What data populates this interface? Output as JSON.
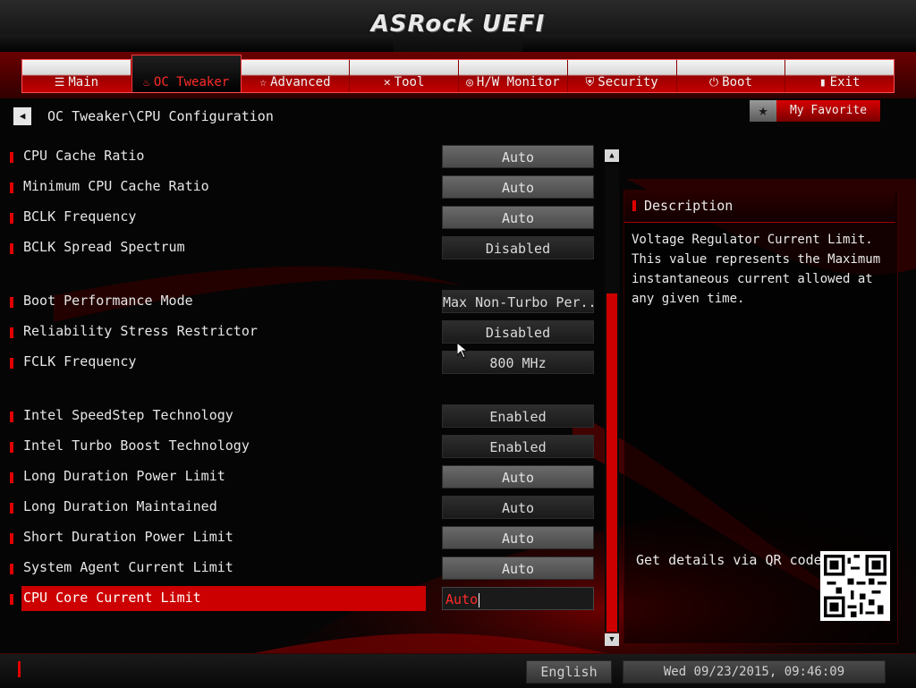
{
  "header": {
    "brand": "ASRock UEFI"
  },
  "nav": {
    "tabs": [
      {
        "label": "Main",
        "icon": "list-icon",
        "glyph": "☰",
        "active": false
      },
      {
        "label": "OC Tweaker",
        "icon": "flame-icon",
        "glyph": "♨",
        "active": true
      },
      {
        "label": "Advanced",
        "icon": "star-icon",
        "glyph": "☆",
        "active": false
      },
      {
        "label": "Tool",
        "icon": "tools-icon",
        "glyph": "✕",
        "active": false
      },
      {
        "label": "H/W Monitor",
        "icon": "monitor-icon",
        "glyph": "◎",
        "active": false
      },
      {
        "label": "Security",
        "icon": "shield-icon",
        "glyph": "⛨",
        "active": false
      },
      {
        "label": "Boot",
        "icon": "power-icon",
        "glyph": "⏻",
        "active": false
      },
      {
        "label": "Exit",
        "icon": "exit-door-icon",
        "glyph": "▮",
        "active": false
      }
    ]
  },
  "breadcrumb": {
    "path": "OC Tweaker\\CPU Configuration",
    "back_icon": "back-arrow-icon"
  },
  "favorite": {
    "label": "My Favorite",
    "icon": "star-icon"
  },
  "settings": [
    {
      "label": "CPU Cache Ratio",
      "value": "Auto",
      "style": "light"
    },
    {
      "label": "Minimum CPU Cache Ratio",
      "value": "Auto",
      "style": "light"
    },
    {
      "label": "BCLK Frequency",
      "value": "Auto",
      "style": "light"
    },
    {
      "label": "BCLK Spread Spectrum",
      "value": "Disabled",
      "style": "dark"
    },
    {
      "label": "Boot Performance Mode",
      "value": "Max Non-Turbo Per...",
      "style": "dark"
    },
    {
      "label": "Reliability Stress Restrictor",
      "value": "Disabled",
      "style": "dark"
    },
    {
      "label": "FCLK Frequency",
      "value": "800 MHz",
      "style": "dark"
    },
    {
      "label": "Intel SpeedStep Technology",
      "value": "Enabled",
      "style": "dark"
    },
    {
      "label": "Intel Turbo Boost Technology",
      "value": "Enabled",
      "style": "dark"
    },
    {
      "label": "Long Duration Power Limit",
      "value": "Auto",
      "style": "light"
    },
    {
      "label": "Long Duration Maintained",
      "value": "Auto",
      "style": "dark"
    },
    {
      "label": "Short Duration Power Limit",
      "value": "Auto",
      "style": "light"
    },
    {
      "label": "System Agent Current Limit",
      "value": "Auto",
      "style": "light"
    },
    {
      "label": "CPU Core Current Limit",
      "value": "Auto",
      "style": "edit",
      "selected": true
    }
  ],
  "description": {
    "title": "Description",
    "text": "Voltage Regulator Current Limit.\nThis value represents the Maximum\ninstantaneous current allowed at\nany given time.",
    "qr_label": "Get details via QR code"
  },
  "footer": {
    "language": "English",
    "datetime": "Wed 09/23/2015, 09:46:09"
  },
  "colors": {
    "accent": "#cc0000",
    "marker": "#e10000",
    "text": "#e6e6e6"
  }
}
